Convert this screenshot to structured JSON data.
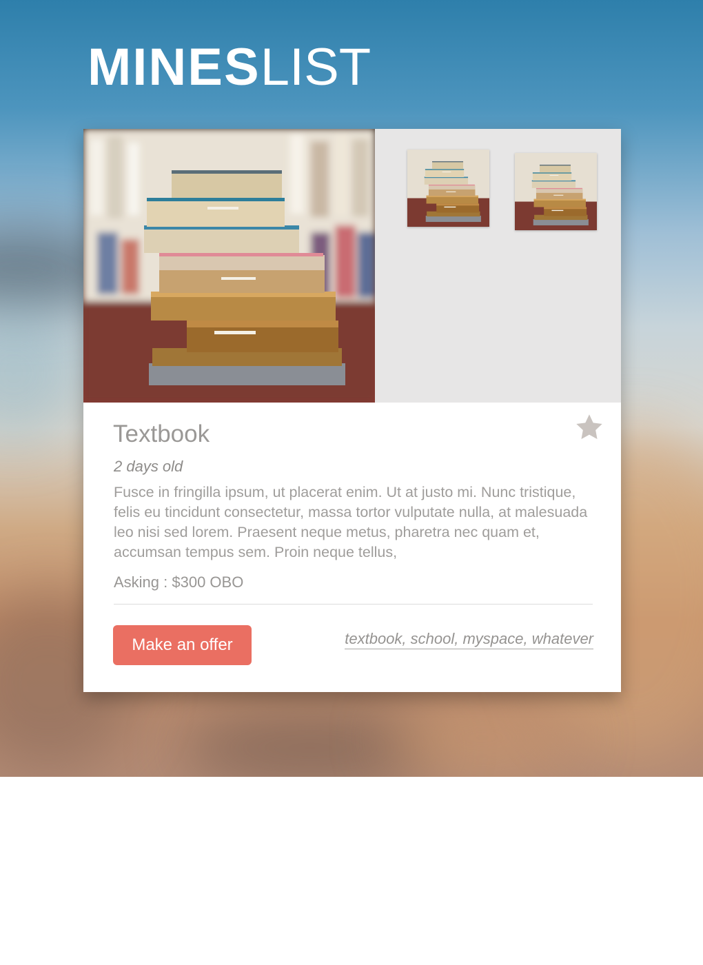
{
  "brand": {
    "bold": "MINES",
    "light": "LIST"
  },
  "listing": {
    "title": "Textbook",
    "age": "2 days old",
    "description": "Fusce in fringilla ipsum, ut placerat enim. Ut at justo mi. Nunc tristique, felis eu tincidunt consectetur, massa tortor vulputate nulla, at malesuada leo nisi sed lorem. Praesent neque metus, pharetra nec quam et, accumsan tempus sem. Proin neque tellus,",
    "price": "Asking : $300 OBO",
    "offer_button": "Make an offer",
    "tags": "textbook, school, myspace, whatever",
    "favorite_icon": "star-icon",
    "favorite_color": "#c9c3bf",
    "accent_color": "#ea6f62"
  },
  "gallery": {
    "main_image": "stack-of-books-photo",
    "thumbnails": [
      "stack-of-books-thumbnail",
      "stack-of-books-thumbnail"
    ]
  }
}
